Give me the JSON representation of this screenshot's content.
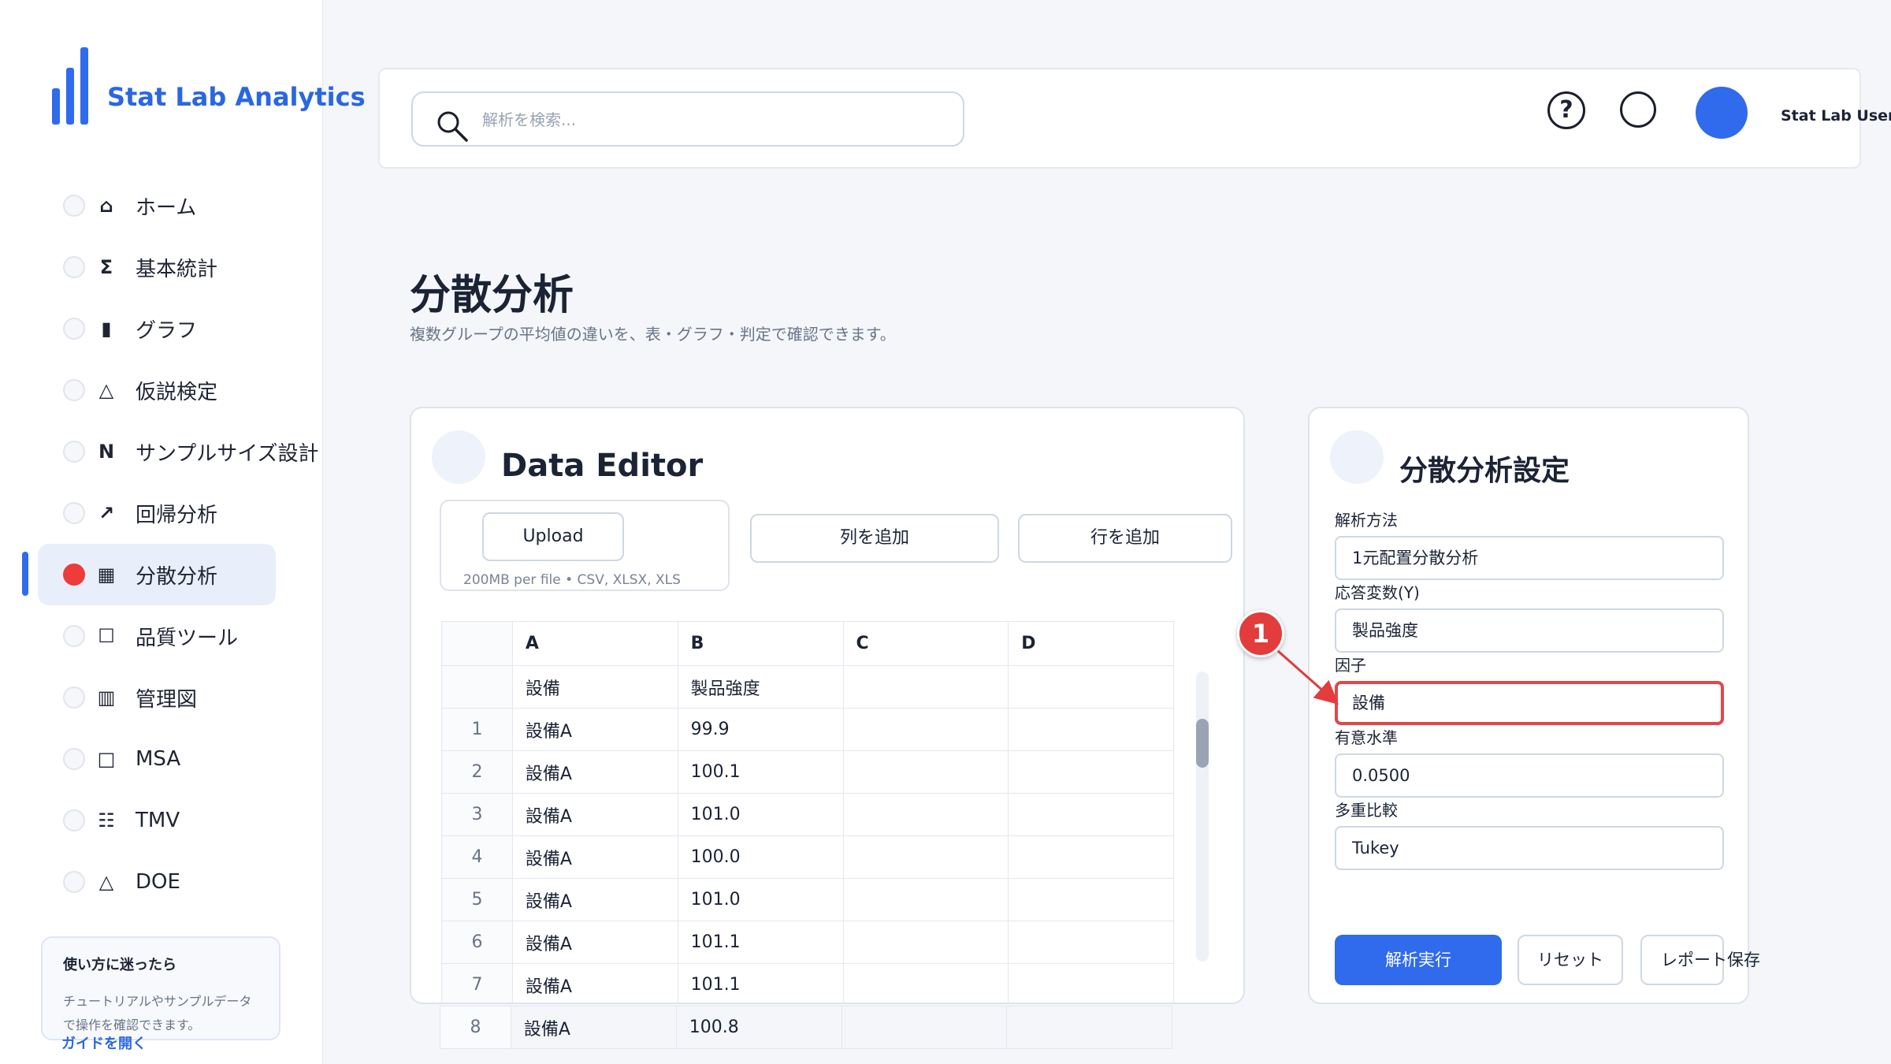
{
  "app": {
    "name": "Stat Lab Analytics"
  },
  "sidebar": {
    "items": [
      {
        "icon": "home-icon",
        "glyph": "⌂",
        "label": "ホーム"
      },
      {
        "icon": "sigma-icon",
        "glyph": "Σ",
        "label": "基本統計"
      },
      {
        "icon": "bar-chart-icon",
        "glyph": "▮",
        "label": "グラフ"
      },
      {
        "icon": "triangle-icon",
        "glyph": "△",
        "label": "仮説検定"
      },
      {
        "icon": "n-icon",
        "glyph": "N",
        "label": "サンプルサイズ設計"
      },
      {
        "icon": "trend-arrow-icon",
        "glyph": "↗",
        "label": "回帰分析"
      },
      {
        "icon": "grid-icon",
        "glyph": "▦",
        "label": "分散分析"
      },
      {
        "icon": "square-icon",
        "glyph": "☐",
        "label": "品質ツール"
      },
      {
        "icon": "control-chart-icon",
        "glyph": "▥",
        "label": "管理図"
      },
      {
        "icon": "square-icon",
        "glyph": "□",
        "label": "MSA"
      },
      {
        "icon": "list-icon",
        "glyph": "☷",
        "label": "TMV"
      },
      {
        "icon": "triangle-icon",
        "glyph": "△",
        "label": "DOE"
      }
    ],
    "active_index": 6,
    "help": {
      "title": "使い方に迷ったら",
      "text": "チュートリアルやサンプルデータで操作を確認できます。",
      "link": "ガイドを開く"
    }
  },
  "header": {
    "search_placeholder": "解析を検索...",
    "help_glyph": "?",
    "user_name": "Stat Lab User"
  },
  "page": {
    "title": "分散分析",
    "subtitle": "複数グループの平均値の違いを、表・グラフ・判定で確認できます。"
  },
  "editor": {
    "title": "Data Editor",
    "upload_label": "Upload",
    "upload_hint": "200MB per file • CSV, XLSX, XLS",
    "add_column": "列を追加",
    "add_row": "行を追加",
    "columns": [
      "A",
      "B",
      "C",
      "D"
    ],
    "header_row": [
      "設備",
      "製品強度",
      "",
      ""
    ],
    "rows": [
      {
        "n": "1",
        "a": "設備A",
        "b": "99.9"
      },
      {
        "n": "2",
        "a": "設備A",
        "b": "100.1"
      },
      {
        "n": "3",
        "a": "設備A",
        "b": "101.0"
      },
      {
        "n": "4",
        "a": "設備A",
        "b": "100.0"
      },
      {
        "n": "5",
        "a": "設備A",
        "b": "101.0"
      },
      {
        "n": "6",
        "a": "設備A",
        "b": "101.1"
      },
      {
        "n": "7",
        "a": "設備A",
        "b": "101.1"
      },
      {
        "n": "8",
        "a": "設備A",
        "b": "100.8"
      }
    ]
  },
  "settings": {
    "title": "分散分析設定",
    "method_label": "解析方法",
    "method_value": "1元配置分散分析",
    "response_label": "応答変数(Y)",
    "response_value": "製品強度",
    "factor_label": "因子",
    "factor_value": "設備",
    "alpha_label": "有意水準",
    "alpha_value": "0.0500",
    "multi_label": "多重比較",
    "multi_value": "Tukey",
    "run_label": "解析実行",
    "reset_label": "リセット",
    "save_label": "レポート保存"
  },
  "annotation": {
    "number": "1",
    "color": "#e23c3c"
  },
  "colors": {
    "accent": "#2f6bec",
    "active_dot": "#ee3b3b",
    "highlight": "#e04848"
  }
}
